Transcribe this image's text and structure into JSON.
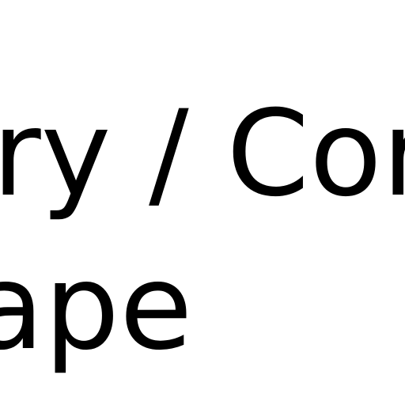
{
  "text": {
    "line1": "ry / Cor",
    "line2": "ape"
  },
  "colors": {
    "background": "#ffffff",
    "text": "#000000"
  }
}
